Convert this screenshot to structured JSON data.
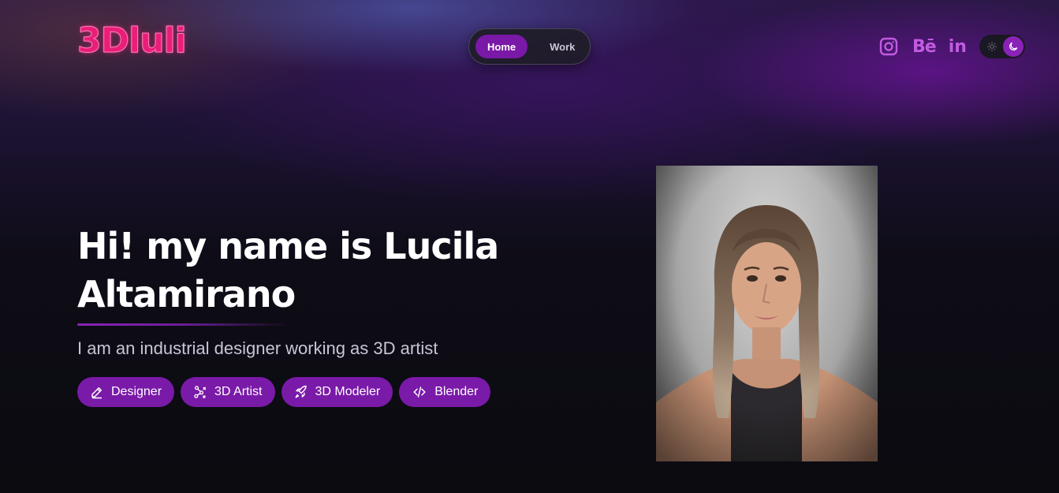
{
  "brand": {
    "logo_text": "3Dluli",
    "logo_color": "#e91e78"
  },
  "nav": {
    "items": [
      {
        "label": "Home",
        "active": true
      },
      {
        "label": "Work",
        "active": false
      }
    ]
  },
  "socials": {
    "items": [
      {
        "icon": "instagram-icon"
      },
      {
        "icon": "behance-icon",
        "label": "Bē"
      },
      {
        "icon": "linkedin-icon",
        "label": "in"
      }
    ]
  },
  "theme_toggle": {
    "icons": [
      "sun-icon",
      "moon-icon"
    ],
    "mode": "dark"
  },
  "hero": {
    "title_line1": "Hi! my name is Lucila",
    "title_line2": "Altamirano",
    "subtitle": "I am an industrial designer working as 3D artist",
    "tags": [
      {
        "label": "Designer",
        "icon": "pencil-icon"
      },
      {
        "label": "3D Artist",
        "icon": "nodes-icon"
      },
      {
        "label": "3D Modeler",
        "icon": "rocket-icon"
      },
      {
        "label": "Blender",
        "icon": "code-icon"
      }
    ]
  },
  "colors": {
    "accent": "#7a1aa8",
    "social": "#c05be0"
  }
}
